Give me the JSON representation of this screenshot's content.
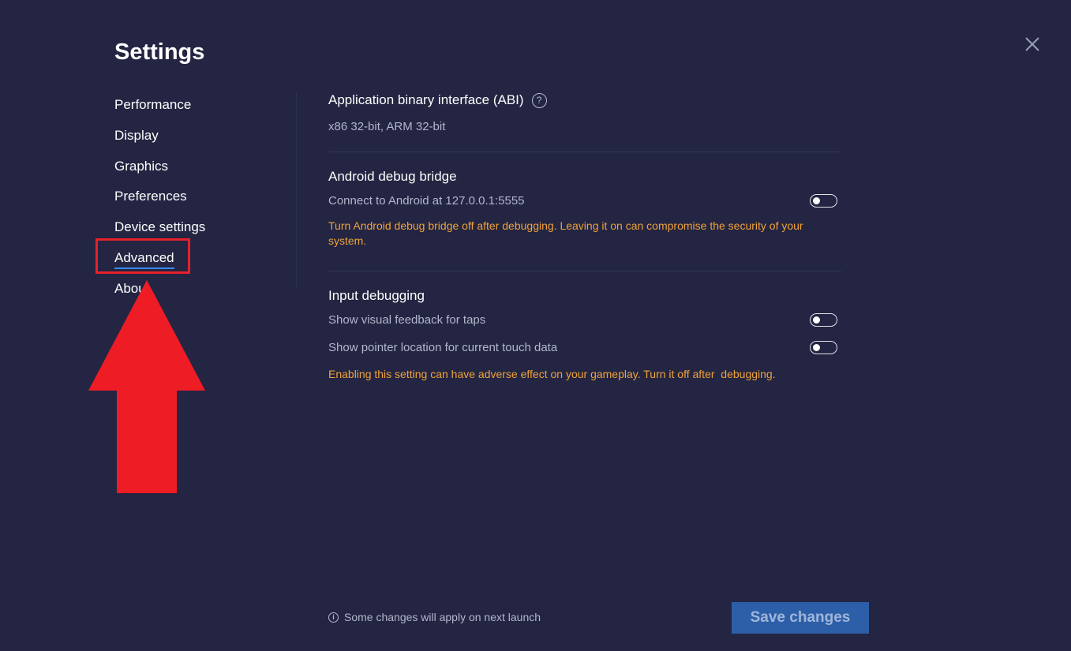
{
  "page": {
    "title": "Settings"
  },
  "sidebar": {
    "items": [
      {
        "label": "Performance"
      },
      {
        "label": "Display"
      },
      {
        "label": "Graphics"
      },
      {
        "label": "Preferences"
      },
      {
        "label": "Device settings"
      },
      {
        "label": "Advanced",
        "active": true
      },
      {
        "label": "About"
      }
    ]
  },
  "content": {
    "abi": {
      "title": "Application binary interface (ABI)",
      "help_icon": "?",
      "value": "x86 32-bit, ARM 32-bit"
    },
    "adb": {
      "title": "Android debug bridge",
      "connect_label": "Connect to Android at 127.0.0.1:5555",
      "connect_enabled": false,
      "warning": "Turn Android debug bridge off after debugging. Leaving it on can compromise the security of your system."
    },
    "input_debugging": {
      "title": "Input debugging",
      "taps_label": "Show visual feedback for taps",
      "taps_enabled": false,
      "pointer_label": "Show pointer location for current touch data",
      "pointer_enabled": false,
      "warning": "Enabling this setting can have adverse effect on your gameplay. Turn it off after  debugging."
    }
  },
  "footer": {
    "info_icon": "i",
    "note": "Some changes will apply on next launch",
    "save_label": "Save changes"
  },
  "colors": {
    "background": "#232542",
    "accent": "#3a8cf5",
    "warning": "#f0a23a",
    "save_button": "#2d5fa8",
    "annotation": "#e8202a"
  }
}
